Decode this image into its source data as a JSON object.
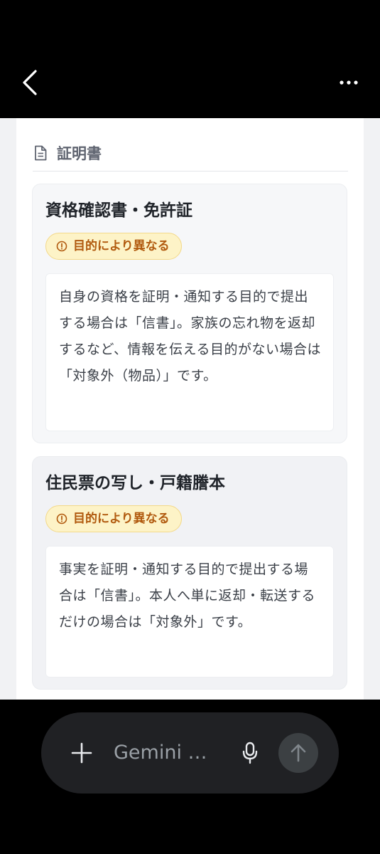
{
  "topbar": {
    "back_icon": "chevron-left-icon",
    "more_icon": "more-horizontal-icon"
  },
  "section": {
    "title": "証明書",
    "icon": "document-icon"
  },
  "cards": [
    {
      "title": "資格確認書・免許証",
      "badge": "目的により異なる",
      "badge_icon": "alert-circle-icon",
      "note": "自身の資格を証明・通知する目的で提出する場合は「信書」。家族の忘れ物を返却するなど、情報を伝える目的がない場合は「対象外（物品）」です。"
    },
    {
      "title": "住民票の写し・戸籍謄本",
      "badge": "目的により異なる",
      "badge_icon": "alert-circle-icon",
      "note": "事実を証明・通知する目的で提出する場合は「信書」。本人へ単に返却・転送するだけの場合は「対象外」です。"
    }
  ],
  "input_bar": {
    "placeholder": "Gemini …",
    "plus_icon": "plus-icon",
    "mic_icon": "microphone-icon",
    "send_icon": "arrow-up-icon"
  },
  "colors": {
    "badge_bg": "#fdf3c7",
    "badge_text": "#b15a0f",
    "title_text": "#1f2329"
  }
}
